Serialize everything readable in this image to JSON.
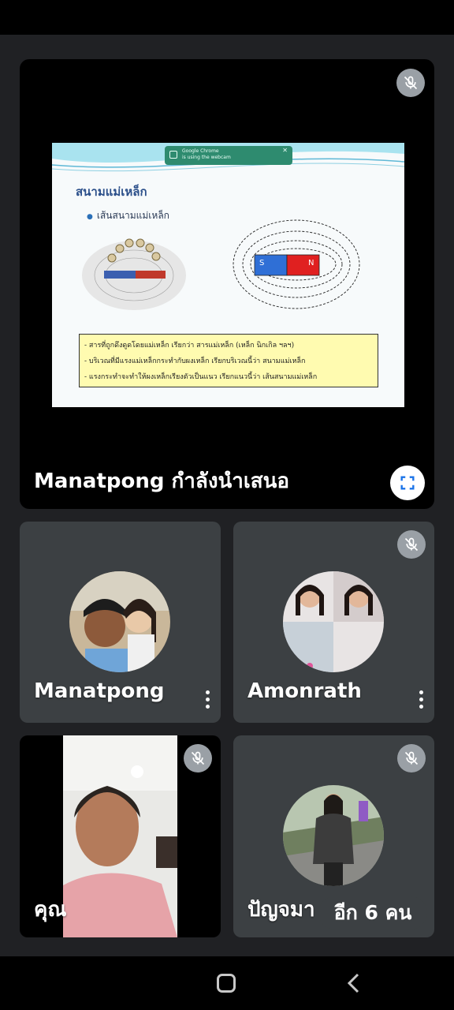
{
  "presenter": {
    "label": "Manatpong กำลังนำเสนอ",
    "slide": {
      "title": "สนามแม่เหล็ก",
      "bullet": "เส้นสนามแม่เหล็ก",
      "magnet_s": "S",
      "magnet_n": "N",
      "lines": [
        "- สารที่ถูกดึงดูดโดยแม่เหล็ก เรียกว่า สารแม่เหล็ก (เหล็ก นิกเกิล ฯลฯ)",
        "- บริเวณที่มีแรงแม่เหล็กกระทำกับผงเหล็ก เรียกบริเวณนี้ว่า สนามแม่เหล็ก",
        "- แรงกระทำจะทำให้ผงเหล็กเรียงตัวเป็นแนว เรียกแนวนี้ว่า เส้นสนามแม่เหล็ก"
      ],
      "toast_title": "Google Chrome",
      "toast_text": "is using the webcam"
    }
  },
  "participants": [
    {
      "name": "Manatpong",
      "muted": false
    },
    {
      "name": "Amonrath",
      "muted": true
    },
    {
      "name": "คุณ",
      "muted": true
    },
    {
      "name": "ปัญจมา",
      "muted": true
    }
  ],
  "more_people": "อีก 6 คน",
  "icons": {
    "mic_off": "mic-off-icon",
    "more": "more-vert-icon",
    "fullscreen": "fullscreen-icon",
    "home": "home-icon",
    "back": "back-icon"
  },
  "colors": {
    "background": "#202124",
    "tile": "#3c4043",
    "mic_off_bg": "#9aa0a6",
    "magnet_s": "#2f6fd6",
    "magnet_n": "#e02020"
  }
}
